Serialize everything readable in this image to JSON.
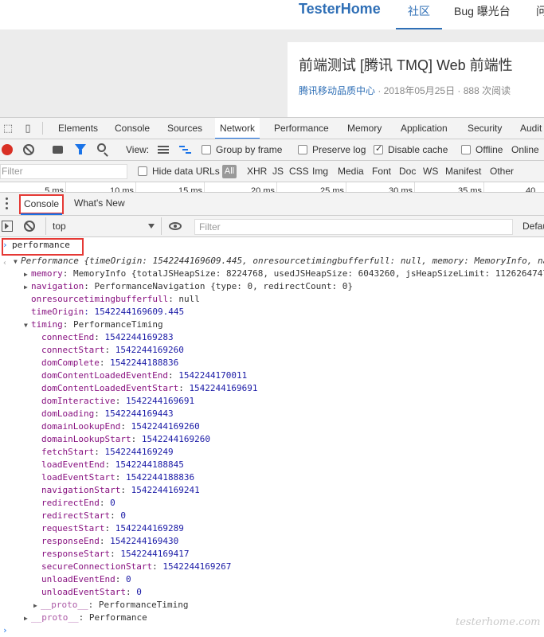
{
  "site": {
    "brand": "TesterHome",
    "nav": {
      "active": "社区",
      "bug": "Bug 曝光台",
      "more": "问"
    }
  },
  "article": {
    "title": "前端测试 [腾讯 TMQ] Web 前端性",
    "author": "腾讯移动品质中心",
    "meta": " · 2018年05月25日 · 888 次阅读"
  },
  "devtools": {
    "main_tabs": [
      "Elements",
      "Console",
      "Sources",
      "Network",
      "Performance",
      "Memory",
      "Application",
      "Security",
      "Audit"
    ],
    "active_tab": "Network",
    "network_bar": {
      "view_label": "View:",
      "group_by_frame": "Group by frame",
      "preserve_log": "Preserve log",
      "disable_cache": "Disable cache",
      "offline": "Offline",
      "online": "Online",
      "group_by_frame_checked": false,
      "preserve_log_checked": false,
      "disable_cache_checked": true,
      "offline_checked": false
    },
    "filter_bar": {
      "filter_placeholder": "Filter",
      "hide_data_urls": "Hide data URLs",
      "all": "All",
      "types": [
        "XHR",
        "JS",
        "CSS",
        "Img",
        "Media",
        "Font",
        "Doc",
        "WS",
        "Manifest",
        "Other"
      ]
    },
    "timeline_ticks": [
      "5 ms",
      "10 ms",
      "15 ms",
      "20 ms",
      "25 ms",
      "30 ms",
      "35 ms",
      "40"
    ],
    "drawer_tabs": {
      "console": "Console",
      "whats_new": "What's New"
    },
    "console_bar": {
      "context": "top",
      "filter_placeholder": "Filter",
      "default_levels": "Default"
    }
  },
  "console": {
    "command": "performance",
    "result": {
      "summary_head": "Performance",
      "summary_body": " {timeOrigin: 1542244169609.445, onresourcetimingbufferfull: null, memory: MemoryInfo, na",
      "memory_key": "memory",
      "memory_val": ": MemoryInfo {totalJSHeapSize: 8224768, usedJSHeapSize: 6043260, jsHeapSizeLimit: 1126264747",
      "navigation_key": "navigation",
      "navigation_val": ": PerformanceNavigation {type: 0, redirectCount: 0}",
      "onresource_key": "onresourcetimingbufferfull",
      "onresource_val": ": null",
      "timeorigin_key": "timeOrigin",
      "timeorigin_val": ": 1542244169609.445",
      "timing_key": "timing",
      "timing_val": ": PerformanceTiming",
      "timing": [
        {
          "k": "connectEnd",
          "v": "1542244169283"
        },
        {
          "k": "connectStart",
          "v": "1542244169260"
        },
        {
          "k": "domComplete",
          "v": "1542244188836"
        },
        {
          "k": "domContentLoadedEventEnd",
          "v": "1542244170011"
        },
        {
          "k": "domContentLoadedEventStart",
          "v": "1542244169691"
        },
        {
          "k": "domInteractive",
          "v": "1542244169691"
        },
        {
          "k": "domLoading",
          "v": "1542244169443"
        },
        {
          "k": "domainLookupEnd",
          "v": "1542244169260"
        },
        {
          "k": "domainLookupStart",
          "v": "1542244169260"
        },
        {
          "k": "fetchStart",
          "v": "1542244169249"
        },
        {
          "k": "loadEventEnd",
          "v": "1542244188845"
        },
        {
          "k": "loadEventStart",
          "v": "1542244188836"
        },
        {
          "k": "navigationStart",
          "v": "1542244169241"
        },
        {
          "k": "redirectEnd",
          "v": "0"
        },
        {
          "k": "redirectStart",
          "v": "0"
        },
        {
          "k": "requestStart",
          "v": "1542244169289"
        },
        {
          "k": "responseEnd",
          "v": "1542244169430"
        },
        {
          "k": "responseStart",
          "v": "1542244169417"
        },
        {
          "k": "secureConnectionStart",
          "v": "1542244169267"
        },
        {
          "k": "unloadEventEnd",
          "v": "0"
        },
        {
          "k": "unloadEventStart",
          "v": "0"
        }
      ],
      "timing_proto_key": "__proto__",
      "timing_proto_val": ": PerformanceTiming",
      "proto_key": "__proto__",
      "proto_val": ": Performance"
    }
  },
  "watermark": "testerhome.com"
}
